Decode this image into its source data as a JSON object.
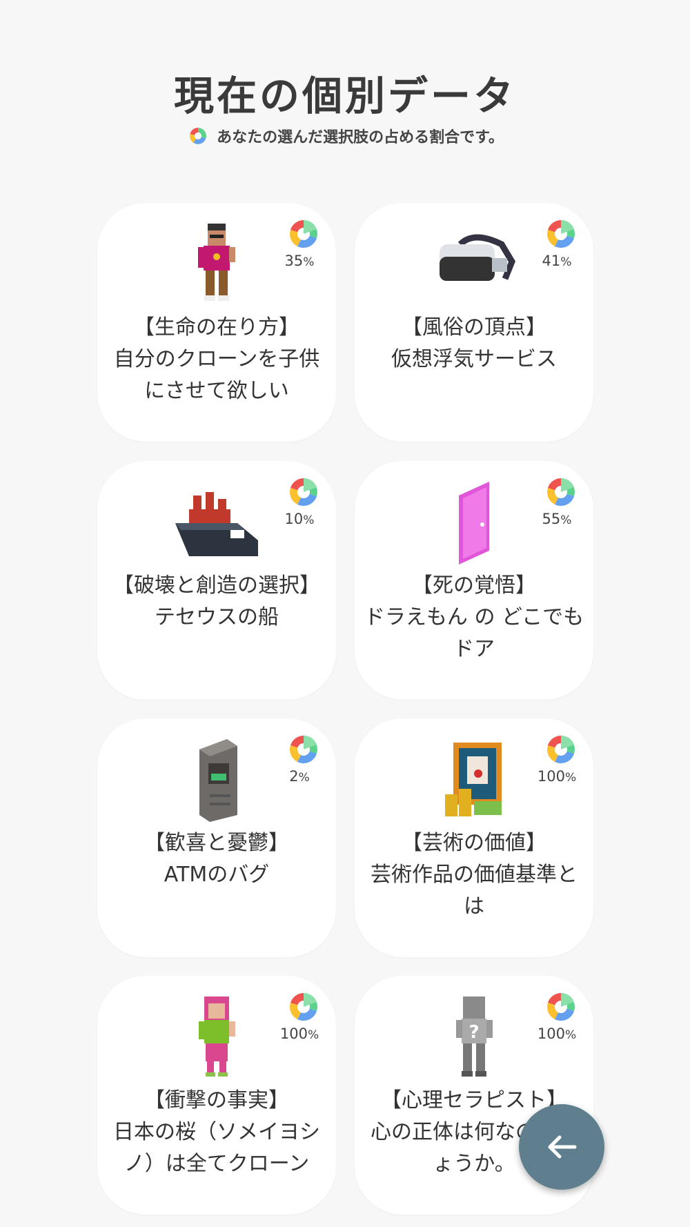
{
  "header": {
    "title": "現在の個別データ",
    "subtitle": "あなたの選んだ選択肢の占める割合です。"
  },
  "cards": [
    {
      "percent": "35",
      "unit": "%",
      "category": "【生命の在り方】",
      "text": "自分のクローンを子供にさせて欲しい",
      "icon": "voxel-man-icon"
    },
    {
      "percent": "41",
      "unit": "%",
      "category": "【風俗の頂点】",
      "text": "仮想浮気サービス",
      "icon": "vr-headset-icon"
    },
    {
      "percent": "10",
      "unit": "%",
      "category": "【破壊と創造の選択】",
      "text": "テセウスの船",
      "icon": "ship-icon"
    },
    {
      "percent": "55",
      "unit": "%",
      "category": "【死の覚悟】",
      "text": "ドラえもん の どこでもドア",
      "icon": "pink-door-icon"
    },
    {
      "percent": "2",
      "unit": "%",
      "category": "【歓喜と憂鬱】",
      "text": "ATMのバグ",
      "icon": "atm-icon"
    },
    {
      "percent": "100",
      "unit": "%",
      "category": "【芸術の価値】",
      "text": "芸術作品の価値基準とは",
      "icon": "painting-money-icon"
    },
    {
      "percent": "100",
      "unit": "%",
      "category": "【衝撃の事実】",
      "text": "日本の桜（ソメイヨシノ）は全てクローン",
      "icon": "voxel-woman-icon"
    },
    {
      "percent": "100",
      "unit": "%",
      "category": "【心理セラピスト】",
      "text": "心の正体は何なのでしょうか。",
      "icon": "mystery-person-icon"
    }
  ],
  "fab": {
    "icon": "arrow-left-icon"
  },
  "colors": {
    "background": "#f7f7f7",
    "card": "#ffffff",
    "fab": "#5f7f8f",
    "pie_red": "#ef5350",
    "pie_yellow": "#fbc02d",
    "pie_blue": "#64a0f0",
    "pie_green": "#5ad28c"
  }
}
